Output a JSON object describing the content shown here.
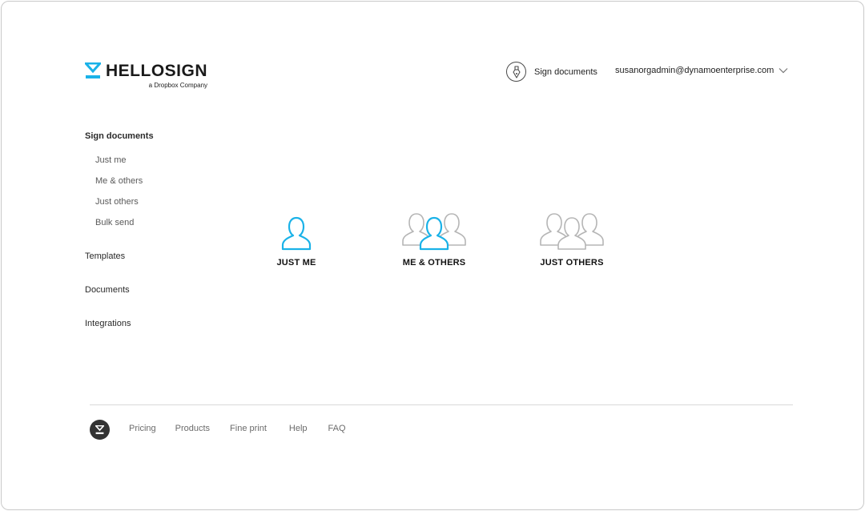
{
  "brand": {
    "name": "HELLOSIGN",
    "tagline": "a Dropbox Company",
    "accent_color": "#1ab2e8"
  },
  "header": {
    "sign_label": "Sign documents",
    "account_email": "susanorgadmin@dynamoenterprise.com"
  },
  "sidebar": {
    "title": "Sign documents",
    "sub_items": [
      {
        "label": "Just me"
      },
      {
        "label": "Me & others"
      },
      {
        "label": "Just others"
      },
      {
        "label": "Bulk send"
      }
    ],
    "items": [
      {
        "label": "Templates"
      },
      {
        "label": "Documents"
      },
      {
        "label": "Integrations"
      }
    ]
  },
  "options": [
    {
      "label": "JUST ME",
      "icon": "single-user-icon"
    },
    {
      "label": "ME & OTHERS",
      "icon": "me-and-others-icon"
    },
    {
      "label": "JUST OTHERS",
      "icon": "others-group-icon"
    }
  ],
  "footer": {
    "links": [
      {
        "label": "Pricing"
      },
      {
        "label": "Products"
      },
      {
        "label": "Fine print"
      },
      {
        "label": "Help"
      },
      {
        "label": "FAQ"
      }
    ]
  }
}
